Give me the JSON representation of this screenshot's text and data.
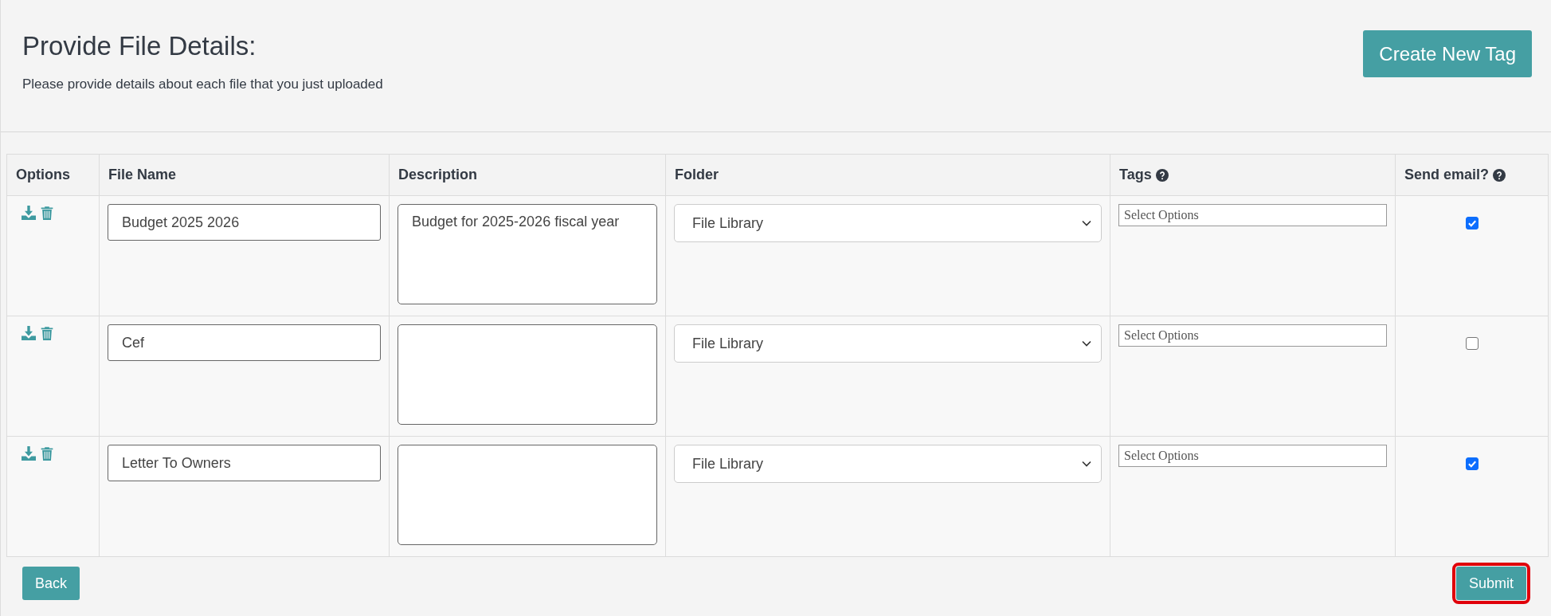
{
  "header": {
    "title": "Provide File Details:",
    "subtitle": "Please provide details about each file that you just uploaded",
    "create_button": "Create New Tag"
  },
  "table": {
    "columns": [
      {
        "label": "Options",
        "help": false
      },
      {
        "label": "File Name",
        "help": false
      },
      {
        "label": "Description",
        "help": false
      },
      {
        "label": "Folder",
        "help": false
      },
      {
        "label": "Tags",
        "help": true
      },
      {
        "label": "Send email?",
        "help": true
      }
    ],
    "rows": [
      {
        "file_name": "Budget 2025 2026",
        "description": "Budget for 2025-2026 fiscal year",
        "folder": "File Library",
        "tags_placeholder": "Select Options",
        "send_email": true
      },
      {
        "file_name": "Cef",
        "description": "",
        "folder": "File Library",
        "tags_placeholder": "Select Options",
        "send_email": false
      },
      {
        "file_name": "Letter To Owners",
        "description": "",
        "folder": "File Library",
        "tags_placeholder": "Select Options",
        "send_email": true
      }
    ]
  },
  "footer": {
    "back_button": "Back",
    "submit_button": {
      "label": "Submit",
      "highlighted": true
    }
  }
}
